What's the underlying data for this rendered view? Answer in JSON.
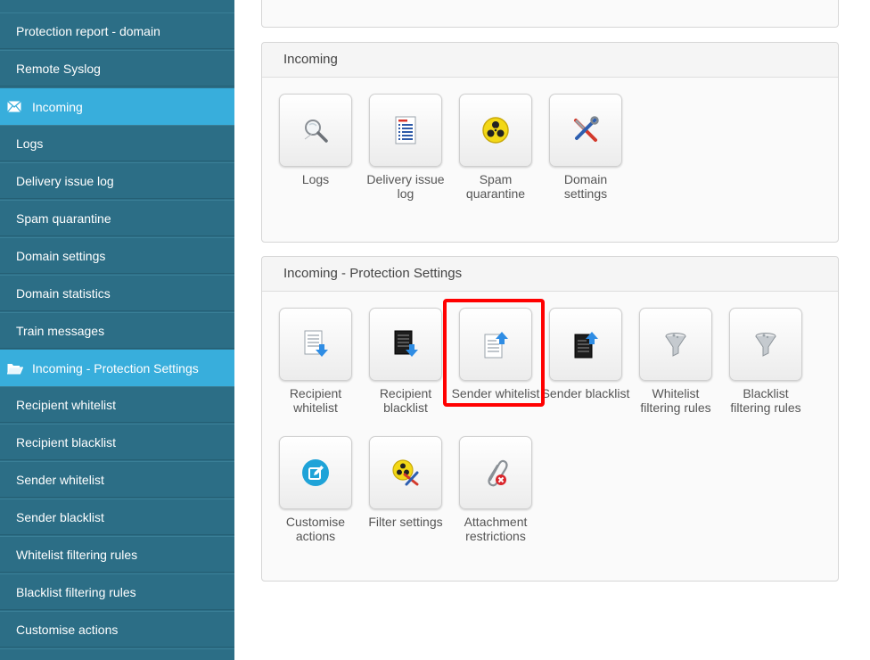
{
  "sidebar": {
    "items": [
      {
        "label": "Protection report - domain",
        "type": "item"
      },
      {
        "label": "Remote Syslog",
        "type": "item"
      },
      {
        "label": "Incoming",
        "type": "section",
        "icon": "envelope-icon"
      },
      {
        "label": "Logs",
        "type": "item"
      },
      {
        "label": "Delivery issue log",
        "type": "item"
      },
      {
        "label": "Spam quarantine",
        "type": "item"
      },
      {
        "label": "Domain settings",
        "type": "item"
      },
      {
        "label": "Domain statistics",
        "type": "item"
      },
      {
        "label": "Train messages",
        "type": "item"
      },
      {
        "label": "Incoming - Protection Settings",
        "type": "section",
        "icon": "folder-open-icon"
      },
      {
        "label": "Recipient whitelist",
        "type": "item"
      },
      {
        "label": "Recipient blacklist",
        "type": "item"
      },
      {
        "label": "Sender whitelist",
        "type": "item"
      },
      {
        "label": "Sender blacklist",
        "type": "item"
      },
      {
        "label": "Whitelist filtering rules",
        "type": "item"
      },
      {
        "label": "Blacklist filtering rules",
        "type": "item"
      },
      {
        "label": "Customise actions",
        "type": "item"
      }
    ]
  },
  "incoming_panel": {
    "title": "Incoming",
    "tiles": [
      {
        "label": "Logs",
        "icon": "magnifier-icon"
      },
      {
        "label": "Delivery issue log",
        "icon": "document-list-icon"
      },
      {
        "label": "Spam quarantine",
        "icon": "biohazard-icon"
      },
      {
        "label": "Domain settings",
        "icon": "tools-icon"
      }
    ]
  },
  "protection_panel": {
    "title": "Incoming - Protection Settings",
    "tiles": [
      {
        "label": "Recipient whitelist",
        "icon": "white-list-down-icon"
      },
      {
        "label": "Recipient blacklist",
        "icon": "black-list-down-icon"
      },
      {
        "label": "Sender whitelist",
        "icon": "white-list-up-icon"
      },
      {
        "label": "Sender blacklist",
        "icon": "black-list-up-icon"
      },
      {
        "label": "Whitelist filtering rules",
        "icon": "funnel-icon"
      },
      {
        "label": "Blacklist filtering rules",
        "icon": "funnel-icon"
      },
      {
        "label": "Customise actions",
        "icon": "edit-circle-icon"
      },
      {
        "label": "Filter settings",
        "icon": "biohazard-tools-icon"
      },
      {
        "label": "Attachment restrictions",
        "icon": "paperclip-blocked-icon"
      }
    ]
  },
  "colors": {
    "sidebar_bg": "#2c6e86",
    "sidebar_section_bg": "#38aedc",
    "highlight": "#ff0000"
  }
}
